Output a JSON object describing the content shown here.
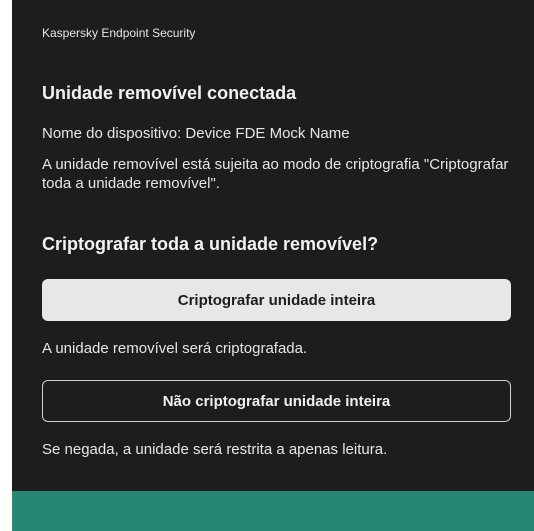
{
  "window": {
    "app_title": "Kaspersky Endpoint Security"
  },
  "dialog": {
    "heading": "Unidade removível conectada",
    "device_name_line": "Nome do dispositivo: Device FDE Mock Name",
    "policy_line": "A unidade removível está sujeita ao modo de criptografia \"Criptografar toda a unidade removível\".",
    "question": "Criptografar toda a unidade removível?",
    "encrypt_button_label": "Criptografar unidade inteira",
    "encrypt_hint": "A unidade removível será criptografada.",
    "decline_button_label": "Não criptografar unidade inteira",
    "decline_hint": "Se negada, a unidade será restrita a apenas leitura."
  },
  "colors": {
    "background": "#1d1d1b",
    "primary_button": "#e7e7e7",
    "accent_bar": "#248872"
  }
}
